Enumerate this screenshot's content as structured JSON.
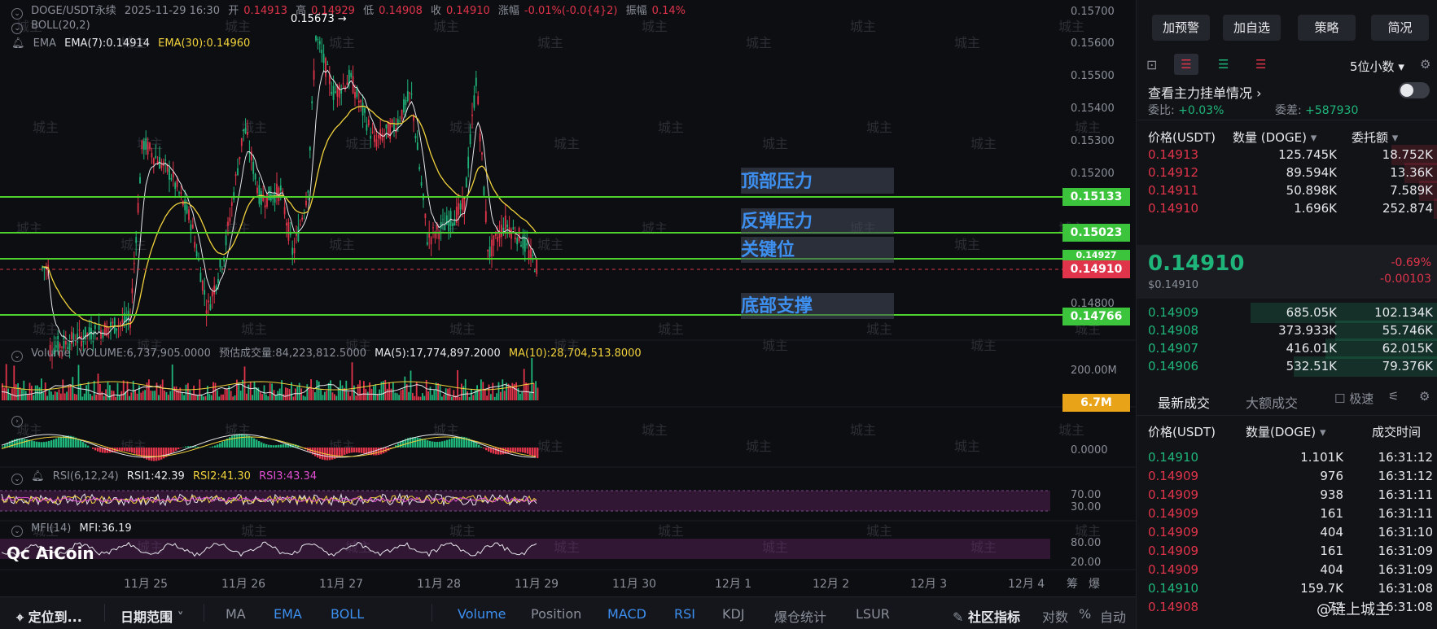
{
  "header": {
    "symbol": "DOGE/USDT永续",
    "datetime": "2025-11-29 16:30",
    "open_label": "开",
    "open": "0.14913",
    "high_label": "高",
    "high": "0.14929",
    "low_label": "低",
    "low": "0.14908",
    "close_label": "收",
    "close": "0.14910",
    "change_label": "涨幅",
    "change": "-0.01%(-0.0{4}2)",
    "amp_label": "振幅",
    "amp": "0.14%",
    "boll": "BOLL(20,2)",
    "ema_label": "EMA",
    "ema7": "EMA(7):0.14914",
    "ema30": "EMA(30):0.14960",
    "peak": "0.15673 →"
  },
  "y_axis": [
    "0.15700",
    "0.15600",
    "0.15500",
    "0.15400",
    "0.15300",
    "0.15200",
    "0.14800"
  ],
  "zones": [
    {
      "label": "顶部压力"
    },
    {
      "label": "反弹压力"
    },
    {
      "label": "关键位"
    },
    {
      "label": "底部支撑"
    }
  ],
  "levels": {
    "top": "0.15133",
    "rebound": "0.15023",
    "key": "0.14927",
    "current": "0.14910",
    "support": "0.14766"
  },
  "volume": {
    "label": "Volume",
    "value": "VOLUME:6,737,905.0000",
    "estimate": "预估成交量:84,223,812.5000",
    "ma5": "MA(5):17,774,897.2000",
    "ma10": "MA(10):28,704,513.8000",
    "axis": "200.00M",
    "tag": "6.7M"
  },
  "macd": {
    "axis": "0.0000"
  },
  "rsi": {
    "label": "RSI(6,12,24)",
    "rsi1": "RSI1:42.39",
    "rsi2": "RSI2:41.30",
    "rsi3": "RSI3:43.34",
    "axis_hi": "70.00",
    "axis_lo": "30.00"
  },
  "mfi": {
    "label": "MFI(14)",
    "value": "MFI:36.19",
    "axis_hi": "80.00",
    "axis_lo": "20.00"
  },
  "logo": "AiCoin",
  "watermark": "城主",
  "x_axis": [
    "11月 25",
    "11月 26",
    "11月 27",
    "11月 28",
    "11月 29",
    "11月 30",
    "12月 1",
    "12月 2",
    "12月 3",
    "12月 4"
  ],
  "x_extra": [
    "筹",
    "爆"
  ],
  "toolbar": {
    "locate": "定位到...",
    "date_range": "日期范围",
    "items": [
      "MA",
      "EMA",
      "BOLL",
      "Volume",
      "Position",
      "MACD",
      "RSI",
      "KDJ",
      "爆仓统计",
      "LSUR"
    ],
    "indicator": "社区指标",
    "log": "对数",
    "pct": "%",
    "auto": "自动"
  },
  "panel": {
    "buttons": [
      "加预警",
      "加自选",
      "策略",
      "简况"
    ],
    "decimals": "5位小数",
    "main_orders": "查看主力挂单情况",
    "ratio_label": "委比:",
    "ratio": "+0.03%",
    "diff_label": "委差:",
    "diff": "+587930",
    "book_headers": [
      "价格(USDT)",
      "数量 (DOGE)",
      "委托额"
    ],
    "asks": [
      {
        "p": "0.14913",
        "q": "125.745K",
        "a": "18.752K",
        "w": 0.25
      },
      {
        "p": "0.14912",
        "q": "89.594K",
        "a": "13.36K",
        "w": 0.18
      },
      {
        "p": "0.14911",
        "q": "50.898K",
        "a": "7.589K",
        "w": 0.1
      },
      {
        "p": "0.14910",
        "q": "1.696K",
        "a": "252.874",
        "w": 0.02
      }
    ],
    "last_price": "0.14910",
    "last_usd": "$0.14910",
    "last_pct": "-0.69%",
    "last_chg": "-0.00103",
    "bids": [
      {
        "p": "0.14909",
        "q": "685.05K",
        "a": "102.134K",
        "w": 1.0
      },
      {
        "p": "0.14908",
        "q": "373.933K",
        "a": "55.746K",
        "w": 0.55
      },
      {
        "p": "0.14907",
        "q": "416.01K",
        "a": "62.015K",
        "w": 0.6
      },
      {
        "p": "0.14906",
        "q": "532.51K",
        "a": "79.376K",
        "w": 0.77
      }
    ],
    "tabs": [
      "最新成交",
      "大额成交"
    ],
    "fast": "极速",
    "trade_headers": [
      "价格(USDT)",
      "数量(DOGE)",
      "成交时间"
    ],
    "trades": [
      {
        "p": "0.14910",
        "q": "1.101K",
        "t": "16:31:12",
        "up": true
      },
      {
        "p": "0.14909",
        "q": "976",
        "t": "16:31:12",
        "up": false
      },
      {
        "p": "0.14909",
        "q": "938",
        "t": "16:31:11",
        "up": false
      },
      {
        "p": "0.14909",
        "q": "161",
        "t": "16:31:11",
        "up": false
      },
      {
        "p": "0.14909",
        "q": "404",
        "t": "16:31:10",
        "up": false
      },
      {
        "p": "0.14909",
        "q": "161",
        "t": "16:31:09",
        "up": false
      },
      {
        "p": "0.14909",
        "q": "404",
        "t": "16:31:09",
        "up": false
      },
      {
        "p": "0.14910",
        "q": "159.7K",
        "t": "16:31:08",
        "up": true
      },
      {
        "p": "0.14908",
        "q": "72",
        "t": "16:31:08",
        "up": false
      }
    ],
    "credit": "@链上城主"
  }
}
